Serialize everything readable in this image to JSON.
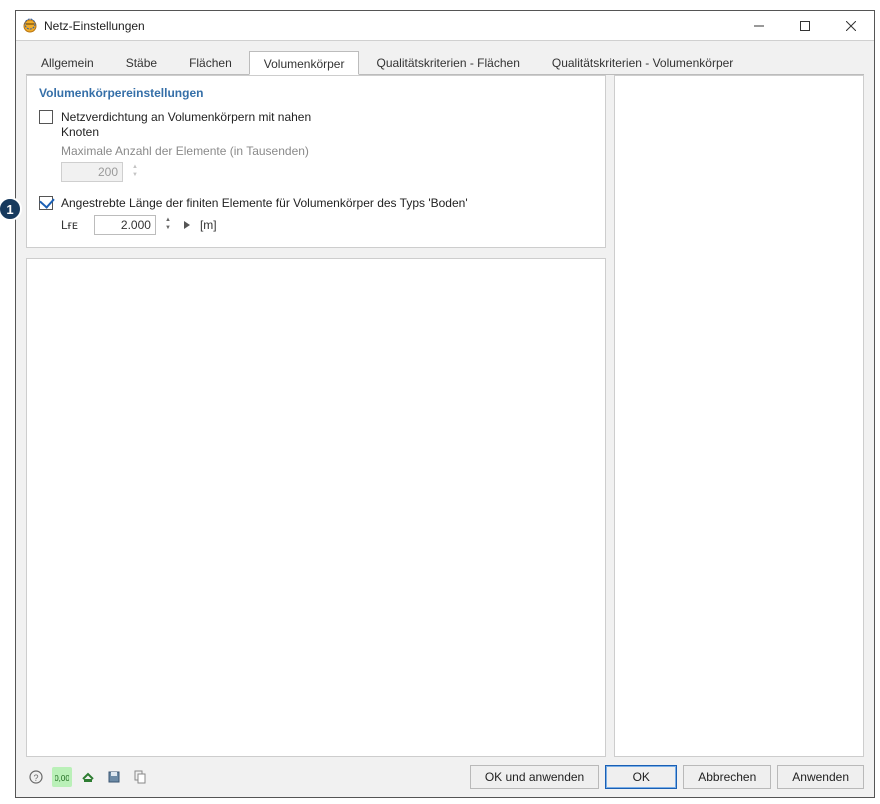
{
  "window": {
    "title": "Netz-Einstellungen"
  },
  "tabs": {
    "t0": "Allgemein",
    "t1": "Stäbe",
    "t2": "Flächen",
    "t3": "Volumenkörper",
    "t4": "Qualitätskriterien - Flächen",
    "t5": "Qualitätskriterien - Volumenkörper"
  },
  "section": {
    "heading": "Volumenkörpereinstellungen",
    "opt1_line1": "Netzverdichtung an Volumenkörpern mit nahen",
    "opt1_line2": "Knoten",
    "opt1_sub": "Maximale Anzahl der Elemente (in Tausenden)",
    "opt1_value": "200",
    "opt2_label": "Angestrebte Länge der finiten Elemente für Volumenkörper des Typs 'Boden'",
    "opt2_symbol": "Lғᴇ",
    "opt2_value": "2.000",
    "opt2_unit": "[m]"
  },
  "footer": {
    "ok_apply": "OK und anwenden",
    "ok": "OK",
    "cancel": "Abbrechen",
    "apply": "Anwenden"
  },
  "callout": "1"
}
